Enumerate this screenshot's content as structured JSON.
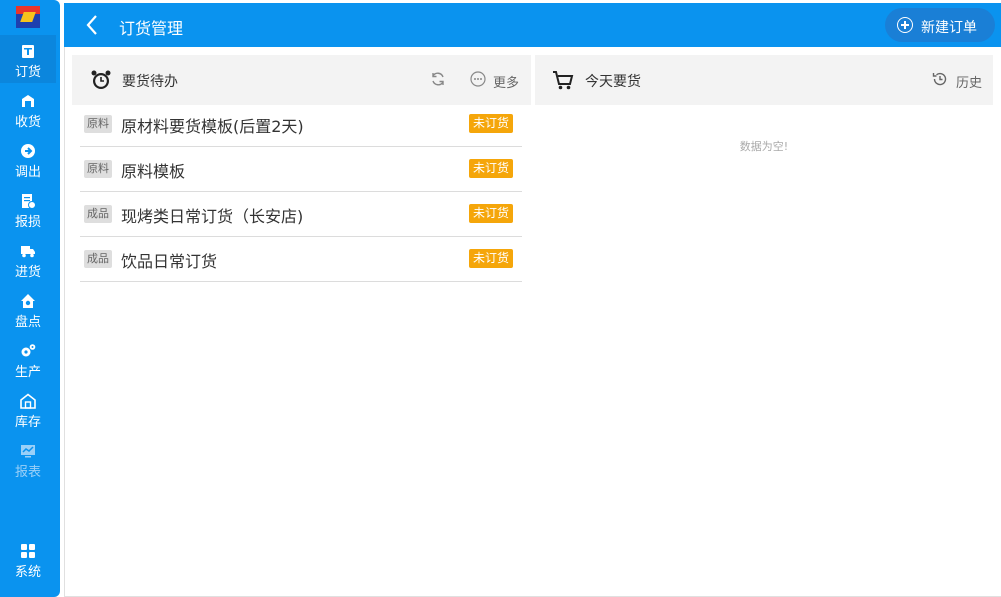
{
  "header": {
    "title": "订货管理",
    "new_order_label": "新建订单"
  },
  "sidebar": {
    "items": [
      {
        "label": "订货",
        "icon": "order-icon"
      },
      {
        "label": "收货",
        "icon": "receive-icon"
      },
      {
        "label": "调出",
        "icon": "transfer-out-icon"
      },
      {
        "label": "报损",
        "icon": "loss-report-icon"
      },
      {
        "label": "进货",
        "icon": "truck-icon"
      },
      {
        "label": "盘点",
        "icon": "stocktake-icon"
      },
      {
        "label": "生产",
        "icon": "gears-icon"
      },
      {
        "label": "库存",
        "icon": "warehouse-icon"
      },
      {
        "label": "报表",
        "icon": "chart-icon"
      },
      {
        "label": "系统",
        "icon": "grid-icon"
      }
    ]
  },
  "pending": {
    "title": "要货待办",
    "more_label": "更多",
    "rows": [
      {
        "tag": "原料",
        "name": "原材料要货模板(后置2天)",
        "status": "未订货"
      },
      {
        "tag": "原料",
        "name": "原料模板",
        "status": "未订货"
      },
      {
        "tag": "成品",
        "name": "现烤类日常订货（长安店)",
        "status": "未订货"
      },
      {
        "tag": "成品",
        "name": "饮品日常订货",
        "status": "未订货"
      }
    ]
  },
  "today": {
    "title": "今天要货",
    "history_label": "历史",
    "empty_text": "数据为空!"
  },
  "colors": {
    "primary": "#0a93ef",
    "badge": "#f5a60a"
  }
}
